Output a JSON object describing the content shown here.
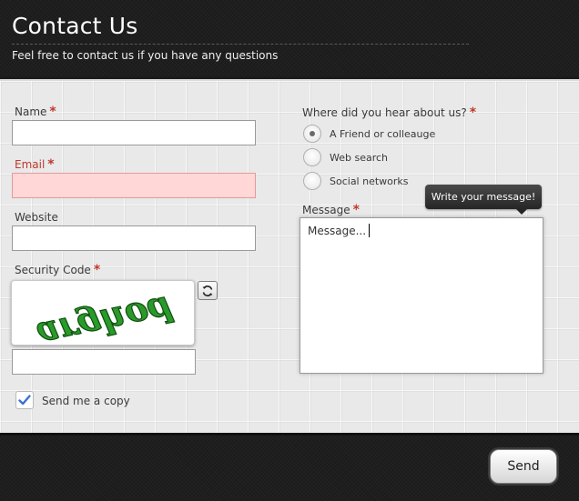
{
  "header": {
    "title": "Contact Us",
    "subtitle": "Feel free to contact us if you have any questions"
  },
  "form": {
    "name": {
      "label": "Name",
      "required_mark": "*",
      "value": ""
    },
    "email": {
      "label": "Email",
      "required_mark": "*",
      "value": "",
      "state": "error"
    },
    "website": {
      "label": "Website",
      "value": ""
    },
    "security": {
      "label": "Security Code",
      "required_mark": "*",
      "captcha_text": "arghod",
      "refresh_icon": "refresh-icon",
      "value": ""
    },
    "copy": {
      "label": "Send me a copy",
      "checked": true
    },
    "referral": {
      "label": "Where did you hear about us?",
      "required_mark": "*",
      "options": [
        "A Friend or colleauge",
        "Web search",
        "Social networks"
      ],
      "selected_index": 0
    },
    "message": {
      "label": "Message",
      "required_mark": "*",
      "value": "Message...",
      "tooltip": "Write your message!"
    }
  },
  "footer": {
    "send_label": "Send"
  },
  "colors": {
    "required": "#c0392b",
    "error_field": "#ffd7d7",
    "captcha_green": "#2a9a2a",
    "checkbox_check": "#3b6fd6"
  }
}
